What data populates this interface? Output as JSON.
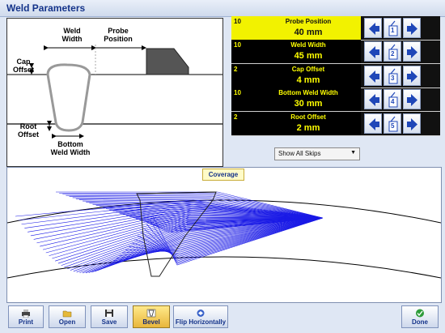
{
  "window": {
    "title": "Weld Parameters"
  },
  "diagram": {
    "weld_width": "Weld\nWidth",
    "probe_position": "Probe\nPosition",
    "cap_offset": "Cap\nOffset",
    "root_offset": "Root\nOffset",
    "bottom_weld_width": "Bottom\nWeld Width"
  },
  "parameters": [
    {
      "step": "10",
      "label": "Probe Position",
      "value": "40 mm",
      "selected": true,
      "index_icon": "1"
    },
    {
      "step": "10",
      "label": "Weld Width",
      "value": "45 mm",
      "selected": false,
      "index_icon": "2"
    },
    {
      "step": "2",
      "label": "Cap Offset",
      "value": "4 mm",
      "selected": false,
      "index_icon": "3"
    },
    {
      "step": "10",
      "label": "Bottom Weld Width",
      "value": "30 mm",
      "selected": false,
      "index_icon": "4"
    },
    {
      "step": "2",
      "label": "Root Offset",
      "value": "2 mm",
      "selected": false,
      "index_icon": "5"
    }
  ],
  "skips_dropdown": {
    "selected": "Show All Skips"
  },
  "plot": {
    "label": "Coverage",
    "ray_color": "#1a1ae6"
  },
  "toolbar": {
    "print": "Print",
    "open": "Open",
    "save": "Save",
    "bevel": "Bevel",
    "flip": "Flip Horizontally",
    "done": "Done"
  },
  "colors": {
    "accent": "#14338a",
    "selected_param": "#f2f200",
    "param_text": "#ffff00"
  }
}
